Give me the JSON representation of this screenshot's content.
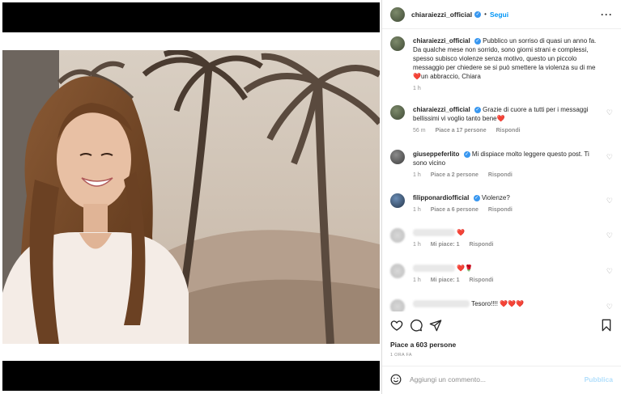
{
  "post": {
    "username": "chiaraiezzi_official",
    "follow_label": "Segui",
    "more_icon": "more-horizontal-icon",
    "likes_text": "Piace a 603 persone",
    "time_ago": "1 ORA FA"
  },
  "comments": [
    {
      "username": "chiaraiezzi_official",
      "text": "Pubblico un sorriso di quasi un anno fa. Da qualche mese non sorrido, sono giorni strani e complessi, spesso subisco violenze senza motivo, questo un piccolo messaggio per chiedere se si può smettere la violenza su di me",
      "text_tail": "un abbraccio, Chiara",
      "time": "1 h"
    },
    {
      "username": "chiaraiezzi_official",
      "text": "Grazie di cuore a tutti per i messaggi bellissimi vi voglio tanto bene",
      "time": "56 m",
      "likes": "Piace a 17 persone",
      "reply": "Rispondi"
    },
    {
      "username": "giuseppeferlito",
      "text": "Mi dispiace molto leggere questo post. Ti sono vicino",
      "time": "1 h",
      "likes": "Piace a 2 persone",
      "reply": "Rispondi"
    },
    {
      "username": "filipponardiofficial",
      "text": "Violenze?",
      "time": "1 h",
      "likes": "Piace a 6 persone",
      "reply": "Rispondi"
    },
    {
      "username": "",
      "text": "",
      "time": "1 h",
      "likes": "Mi piace: 1",
      "reply": "Rispondi"
    },
    {
      "username": "",
      "text": "",
      "time": "1 h",
      "likes": "Mi piace: 1",
      "reply": "Rispondi"
    },
    {
      "username": "",
      "text": "Tesoro!!!!",
      "time": ""
    }
  ],
  "composer": {
    "placeholder": "Aggiungi un commento...",
    "publish_label": "Pubblica"
  },
  "colors": {
    "link_blue": "#0095f6",
    "verified_blue": "#3897f0",
    "heart_red": "#ed4956",
    "muted": "#8e8e8e"
  }
}
